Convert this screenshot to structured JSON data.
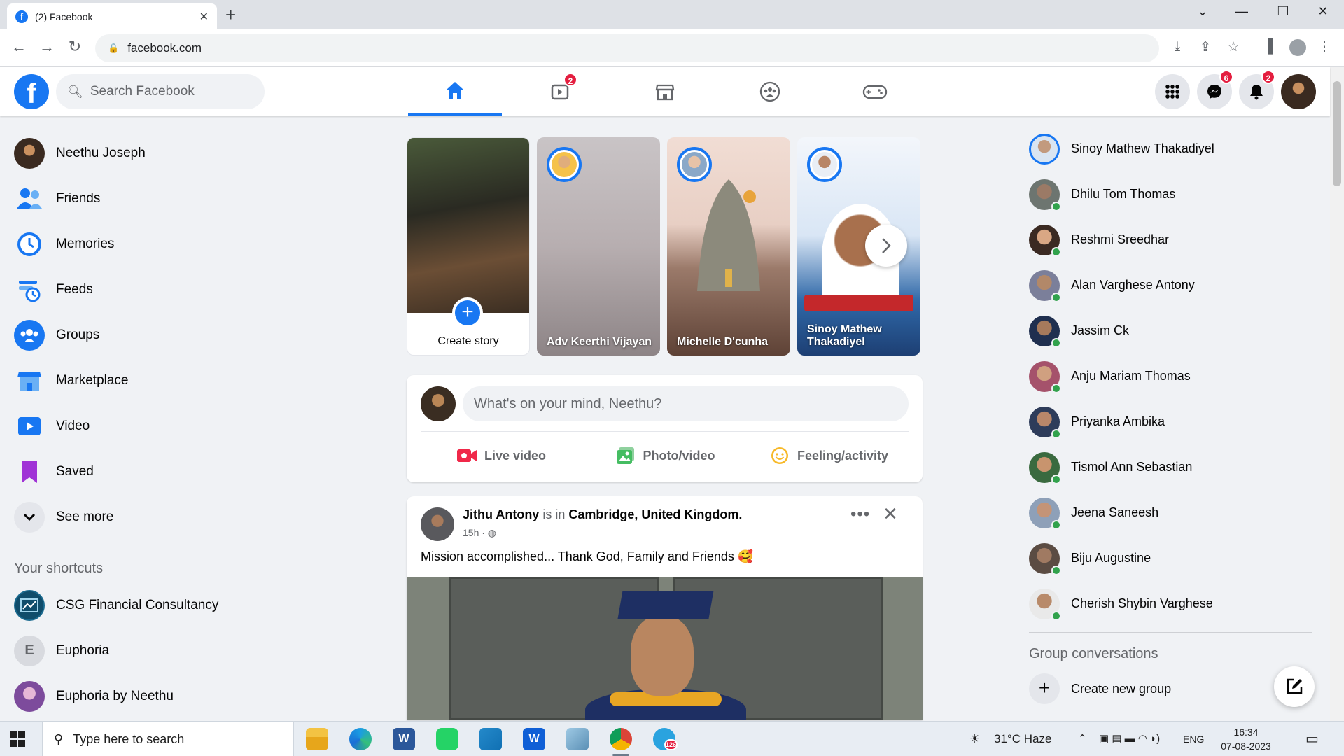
{
  "browser": {
    "tab_title": "(2) Facebook",
    "url": "facebook.com"
  },
  "header": {
    "search_placeholder": "Search Facebook",
    "watch_badge": "2",
    "messenger_badge": "6",
    "notifications_badge": "2"
  },
  "left_nav": {
    "profile_name": "Neethu Joseph",
    "items": [
      {
        "label": "Friends",
        "icon": "friends-icon"
      },
      {
        "label": "Memories",
        "icon": "memories-icon"
      },
      {
        "label": "Feeds",
        "icon": "feeds-icon"
      },
      {
        "label": "Groups",
        "icon": "groups-icon"
      },
      {
        "label": "Marketplace",
        "icon": "marketplace-icon"
      },
      {
        "label": "Video",
        "icon": "video-icon"
      },
      {
        "label": "Saved",
        "icon": "saved-icon"
      }
    ],
    "see_more": "See more",
    "shortcuts_title": "Your shortcuts",
    "shortcuts": [
      {
        "label": "CSG Financial Consultancy"
      },
      {
        "label": "Euphoria",
        "letter": "E"
      },
      {
        "label": "Euphoria by Neethu"
      }
    ]
  },
  "stories": {
    "create_label": "Create story",
    "items": [
      {
        "name": "Adv Keerthi Vijayan"
      },
      {
        "name": "Michelle D'cunha"
      },
      {
        "name": "Sinoy Mathew Thakadiyel"
      }
    ]
  },
  "composer": {
    "placeholder": "What's on your mind, Neethu?",
    "live_video": "Live video",
    "photo_video": "Photo/video",
    "feeling": "Feeling/activity"
  },
  "post": {
    "author": "Jithu Antony",
    "is_in": "is in",
    "location": "Cambridge, United Kingdom.",
    "time": "15h",
    "text": "Mission accomplished... Thank God, Family and Friends 🥰"
  },
  "contacts": {
    "items": [
      {
        "name": "Sinoy Mathew Thakadiyel",
        "online": false
      },
      {
        "name": "Dhilu Tom Thomas",
        "online": true
      },
      {
        "name": "Reshmi Sreedhar",
        "online": true
      },
      {
        "name": "Alan Varghese Antony",
        "online": true
      },
      {
        "name": "Jassim Ck",
        "online": true
      },
      {
        "name": "Anju Mariam Thomas",
        "online": true
      },
      {
        "name": "Priyanka Ambika",
        "online": true
      },
      {
        "name": "Tismol Ann Sebastian",
        "online": true
      },
      {
        "name": "Jeena Saneesh",
        "online": true
      },
      {
        "name": "Biju Augustine",
        "online": true
      },
      {
        "name": "Cherish Shybin Varghese",
        "online": true
      }
    ],
    "group_title": "Group conversations",
    "create_group": "Create new group"
  },
  "taskbar": {
    "search_placeholder": "Type here to search",
    "weather": "31°C  Haze",
    "language": "ENG",
    "time": "16:34",
    "date": "07-08-2023",
    "telegram_badge": "126"
  }
}
